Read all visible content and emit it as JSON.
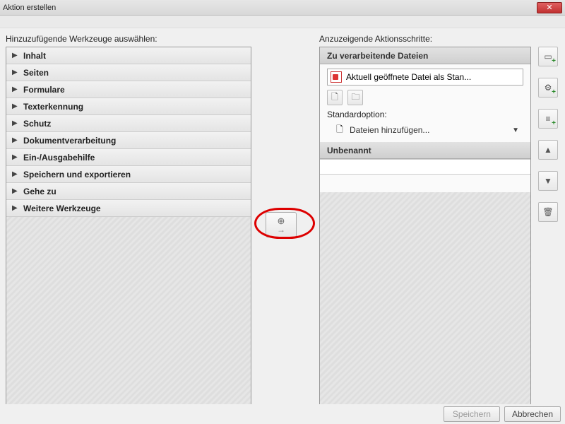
{
  "window": {
    "title": "Aktion erstellen"
  },
  "labels": {
    "left": "Hinzuzufügende Werkzeuge auswählen:",
    "right": "Anzuzeigende Aktionsschritte:"
  },
  "tools": [
    "Inhalt",
    "Seiten",
    "Formulare",
    "Texterkennung",
    "Schutz",
    "Dokumentverarbeitung",
    "Ein-/Ausgabehilfe",
    "Speichern und exportieren",
    "Gehe zu",
    "Weitere Werkzeuge"
  ],
  "steps": {
    "files_header": "Zu verarbeitende Dateien",
    "current_file": "Aktuell geöffnete Datei als Stan...",
    "standard_label": "Standardoption:",
    "add_files": "Dateien hinzufügen...",
    "unnamed": "Unbenannt"
  },
  "footer": {
    "save": "Speichern",
    "cancel": "Abbrechen"
  }
}
